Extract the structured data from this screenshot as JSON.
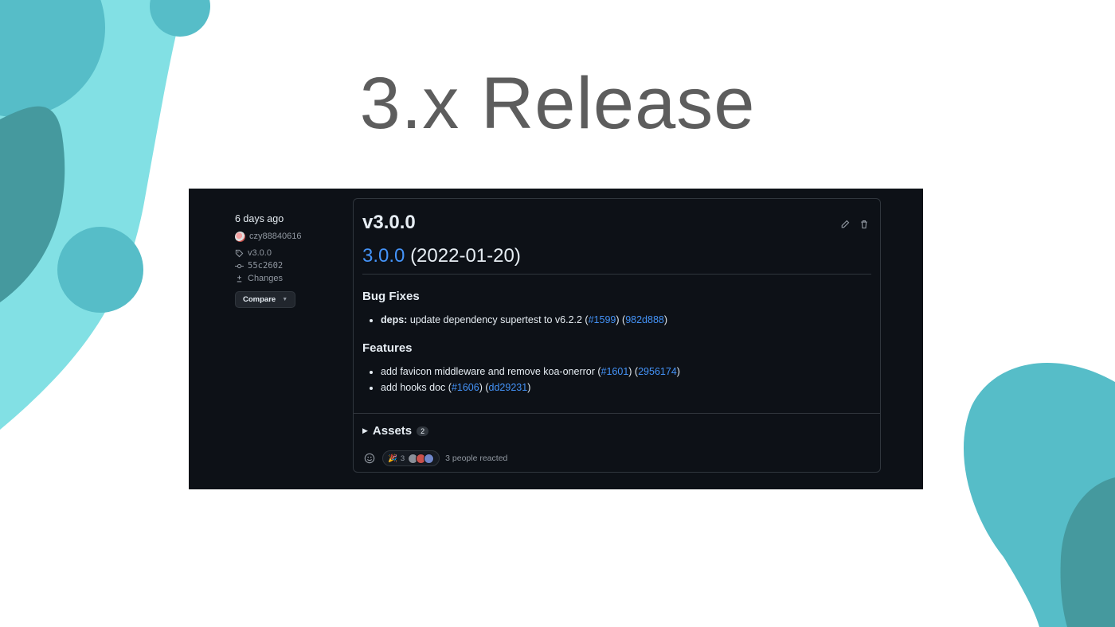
{
  "slide": {
    "title": "3.x Release"
  },
  "meta": {
    "time": "6 days ago",
    "author": "czy88840616",
    "tag": "v3.0.0",
    "commit": "55c2602",
    "changes_label": "Changes",
    "compare_label": "Compare"
  },
  "release": {
    "title": "v3.0.0",
    "version_link": "3.0.0",
    "date": "(2022-01-20)",
    "sections": {
      "bug_fixes": {
        "heading": "Bug Fixes",
        "item0": {
          "scope": "deps:",
          "text": "update dependency supertest to v6.2.2 (",
          "pr": "#1599",
          "mid": ") (",
          "commit": "982d888",
          "end": ")"
        }
      },
      "features": {
        "heading": "Features",
        "item0": {
          "text": "add favicon middleware and remove koa-onerror (",
          "pr": "#1601",
          "mid": ") (",
          "commit": "2956174",
          "end": ")"
        },
        "item1": {
          "text": "add hooks doc (",
          "pr": "#1606",
          "mid": ") (",
          "commit": "dd29231",
          "end": ")"
        }
      }
    },
    "assets_label": "Assets",
    "assets_count": "2",
    "reaction_emoji": "🎉",
    "reaction_count": "3",
    "reacted_text": "3 people reacted"
  },
  "colors": {
    "link": "#4493f8",
    "background": "#0d1117",
    "border": "#30363d",
    "teal_light": "#82e0e4",
    "teal_mid": "#56bdc8",
    "teal_dark": "#45999e"
  },
  "icons": [
    "tag-icon",
    "commit-icon",
    "diff-icon",
    "pencil-icon",
    "trash-icon",
    "smiley-icon"
  ]
}
